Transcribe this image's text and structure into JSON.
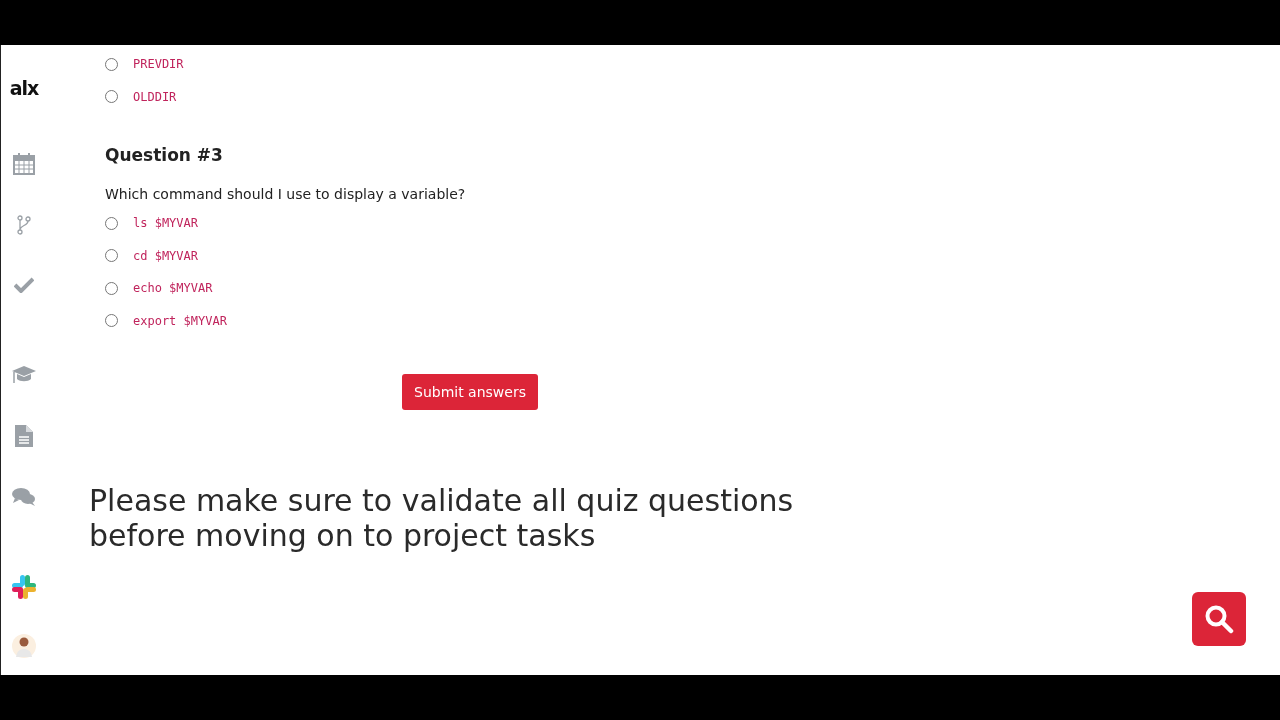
{
  "logo": "alx",
  "previous_options": [
    {
      "label": "PREVDIR",
      "selected": false
    },
    {
      "label": "OLDDIR",
      "selected": false
    }
  ],
  "question": {
    "title": "Question #3",
    "text": "Which command should I use to display a variable?",
    "options": [
      {
        "label": "ls $MYVAR",
        "selected": false
      },
      {
        "label": "cd $MYVAR",
        "selected": false
      },
      {
        "label": "echo $MYVAR",
        "selected": false
      },
      {
        "label": "export $MYVAR",
        "selected": false
      }
    ]
  },
  "submit_button": "Submit answers",
  "caption": "Please make sure to validate all quiz questions before moving on to project tasks"
}
